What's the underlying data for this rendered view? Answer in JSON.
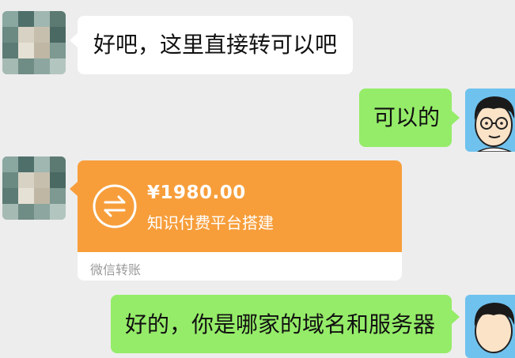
{
  "messages": [
    {
      "side": "left",
      "text": "好吧，这里直接转可以吧"
    },
    {
      "side": "right",
      "text": "可以的"
    },
    {
      "side": "left",
      "type": "transfer",
      "amount": "¥1980.00",
      "memo": "知识付费平台搭建",
      "label": "微信转账"
    },
    {
      "side": "right",
      "text": "好的，你是哪家的域名和服务器"
    }
  ],
  "avatars": {
    "contact": "pixelated-avatar",
    "self": "cartoon-man-glasses-avatar"
  },
  "colors": {
    "background": "#ededed",
    "incoming_bubble": "#ffffff",
    "outgoing_bubble": "#95ec69",
    "transfer_card": "#f79e3b"
  }
}
